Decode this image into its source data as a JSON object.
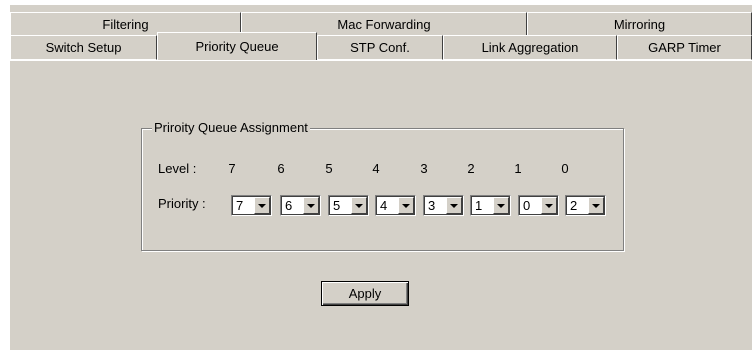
{
  "tabs_back": [
    "Filtering",
    "Mac Forwarding",
    "Mirroring"
  ],
  "tabs_front": [
    "Switch Setup",
    "Priority Queue",
    "STP Conf.",
    "Link Aggregation",
    "GARP Timer"
  ],
  "selected_tab": "Priority Queue",
  "group": {
    "title": "Priroity Queue Assignment",
    "level_label": "Level :",
    "priority_label": "Priority :",
    "levels": [
      "7",
      "6",
      "5",
      "4",
      "3",
      "2",
      "1",
      "0"
    ],
    "priorities": [
      "7",
      "6",
      "5",
      "4",
      "3",
      "1",
      "0",
      "2"
    ]
  },
  "apply_label": "Apply"
}
